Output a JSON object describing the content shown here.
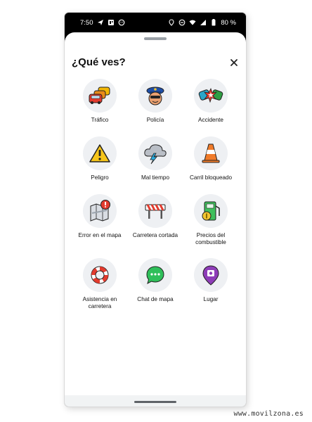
{
  "status_bar": {
    "time": "7:50",
    "battery": "80 %"
  },
  "sheet": {
    "title": "¿Qué ves?",
    "close_icon": "close-icon"
  },
  "items": [
    {
      "label": "Tráfico",
      "icon": "traffic-icon"
    },
    {
      "label": "Policía",
      "icon": "police-icon"
    },
    {
      "label": "Accidente",
      "icon": "accident-icon"
    },
    {
      "label": "Peligro",
      "icon": "hazard-icon"
    },
    {
      "label": "Mal tiempo",
      "icon": "bad-weather-icon"
    },
    {
      "label": "Carril bloqueado",
      "icon": "lane-blocked-icon"
    },
    {
      "label": "Error en el mapa",
      "icon": "map-error-icon"
    },
    {
      "label": "Carretera cortada",
      "icon": "road-closed-icon"
    },
    {
      "label": "Precios del\ncombustible",
      "icon": "fuel-prices-icon"
    },
    {
      "label": "Asistencia en\ncarretera",
      "icon": "roadside-assistance-icon"
    },
    {
      "label": "Chat de mapa",
      "icon": "map-chat-icon"
    },
    {
      "label": "Lugar",
      "icon": "place-icon"
    }
  ],
  "watermark": "www.movilzona.es"
}
